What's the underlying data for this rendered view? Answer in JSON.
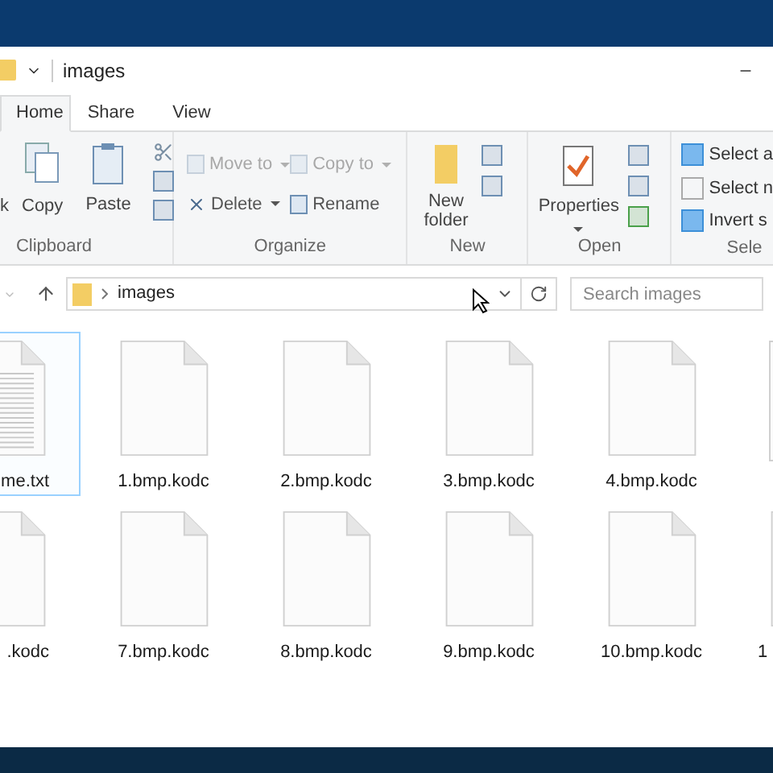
{
  "title_bar": {
    "title": "images"
  },
  "tabs": [
    {
      "label": "Home",
      "selected": true
    },
    {
      "label": "Share",
      "selected": false
    },
    {
      "label": "View",
      "selected": false
    }
  ],
  "ribbon": {
    "clipboard": {
      "cut_label": "k",
      "copy": "Copy",
      "paste": "Paste",
      "group": "Clipboard"
    },
    "organize": {
      "items": [
        {
          "label": "Move to",
          "disabled": true
        },
        {
          "label": "Copy to",
          "disabled": true
        },
        {
          "label": "Delete",
          "disabled": false
        },
        {
          "label": "Rename",
          "disabled": false
        }
      ],
      "group": "Organize"
    },
    "new": {
      "label_1": "New",
      "label_2": "folder",
      "group": "New"
    },
    "open": {
      "label": "Properties",
      "group": "Open"
    },
    "select": {
      "items": [
        "Select a",
        "Select n",
        "Invert s"
      ],
      "group": "Sele"
    }
  },
  "address_bar": {
    "path": "images",
    "search_placeholder": "Search images"
  },
  "files": [
    [
      {
        "name": "me.txt",
        "kind": "text",
        "selected": true
      },
      {
        "name": "1.bmp.kodc",
        "kind": "blank",
        "selected": false
      },
      {
        "name": "2.bmp.kodc",
        "kind": "blank",
        "selected": false
      },
      {
        "name": "3.bmp.kodc",
        "kind": "blank",
        "selected": false
      },
      {
        "name": "4.bmp.kodc",
        "kind": "blank",
        "selected": false
      },
      {
        "kind": "blank",
        "selected": false
      }
    ],
    [
      {
        "name": ".kodc",
        "kind": "blank",
        "selected": false
      },
      {
        "name": "7.bmp.kodc",
        "kind": "blank",
        "selected": false
      },
      {
        "name": "8.bmp.kodc",
        "kind": "blank",
        "selected": false
      },
      {
        "name": "9.bmp.kodc",
        "kind": "blank",
        "selected": false
      },
      {
        "name": "10.bmp.kodc",
        "kind": "blank",
        "selected": false
      },
      {
        "name": "1",
        "kind": "blank",
        "selected": false
      }
    ]
  ]
}
